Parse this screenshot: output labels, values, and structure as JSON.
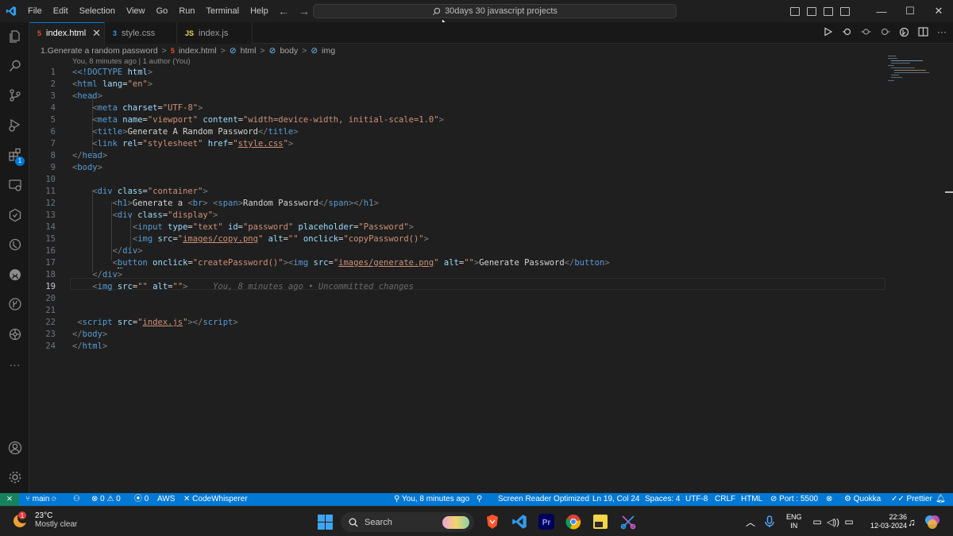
{
  "titlebar": {
    "menu": [
      "File",
      "Edit",
      "Selection",
      "View",
      "Go",
      "Run",
      "Terminal",
      "Help"
    ],
    "search": "30days 30 javascript projects",
    "window_controls": [
      "—",
      "☐",
      "✕"
    ]
  },
  "tabs": [
    {
      "icon_text": "5",
      "label": "index.html",
      "close": "✕"
    },
    {
      "icon_text": "3",
      "label": "style.css"
    },
    {
      "icon_text": "JS",
      "label": "index.js"
    }
  ],
  "activity_badge": "1",
  "breadcrumb": {
    "folder": "1.Generate a random password",
    "file": "index.html",
    "html": "html",
    "body": "body",
    "img": "img"
  },
  "blame_top": "You, 8 minutes ago | 1 author (You)",
  "editor": {
    "line_numbers": [
      "1",
      "2",
      "3",
      "4",
      "5",
      "6",
      "7",
      "8",
      "9",
      "10",
      "11",
      "12",
      "13",
      "14",
      "15",
      "16",
      "17",
      "18",
      "19",
      "20",
      "21",
      "22",
      "23",
      "24"
    ],
    "inline_blame": "You, 8 minutes ago • Uncommitted changes"
  },
  "code_tokens": {
    "doctype": "<!DOCTYPE",
    "html_kw": "html",
    "gt": ">",
    "lt": "<",
    "close_lt": "</",
    "tag_html": "html",
    "attr_lang": "lang",
    "eq": "=",
    "str_en": "\"en\"",
    "tag_head": "head",
    "tag_meta": "meta",
    "attr_charset": "charset",
    "str_utf8": "\"UTF-8\"",
    "attr_name": "name",
    "str_viewport": "\"viewport\"",
    "attr_content": "content",
    "str_content": "\"width=device-width, initial-scale=1.0\"",
    "tag_title": "title",
    "text_title": "Generate A Random Password",
    "tag_link": "link",
    "attr_rel": "rel",
    "str_stylesheet": "\"stylesheet\"",
    "attr_href": "href",
    "q": "\"",
    "str_style_css": "style.css",
    "tag_body": "body",
    "tag_div": "div",
    "attr_class": "class",
    "str_container": "\"container\"",
    "tag_h1": "h1",
    "text_generate_a": "Generate a ",
    "tag_br": "br",
    "tag_span": "span",
    "text_random_password": "Random Password",
    "str_display": "\"display\"",
    "tag_input": "input",
    "attr_type": "type",
    "str_text": "\"text\"",
    "attr_id": "id",
    "str_password": "\"password\"",
    "attr_placeholder": "placeholder",
    "str_Password": "\"Password\"",
    "tag_img": "img",
    "attr_src": "src",
    "str_copy": "images/copy.png",
    "attr_alt": "alt",
    "str_empty": "\"\"",
    "attr_onclick": "onclick",
    "str_copyPassword": "\"copyPassword()\"",
    "tag_button_b": "b",
    "tag_button_rest": "utton",
    "tag_button": "button",
    "str_createPassword": "\"createPassword()\"",
    "str_generate": "images/generate.png",
    "text_generate_password": "Generate Password",
    "tag_script": "script",
    "str_index_js": "index.js"
  },
  "statusbar": {
    "remote": "⨯",
    "branch": "main",
    "sync": "⟳",
    "errors": "⊗ 0 ⚠ 0",
    "ports": "0",
    "aws": "AWS",
    "codewhisperer": "CodeWhisperer",
    "blame": "You, 8 minutes ago",
    "screen_reader": "Screen Reader Optimized",
    "position": "Ln 19, Col 24",
    "spaces": "Spaces: 4",
    "encoding": "UTF-8",
    "eol": "CRLF",
    "language": "HTML",
    "port": "Port : 5500",
    "quokka": "Quokka",
    "prettier": "Prettier"
  },
  "taskbar": {
    "weather_badge": "1",
    "temp": "23°C",
    "condition": "Mostly clear",
    "search": "Search",
    "lang_top": "ENG",
    "lang_bottom": "IN",
    "time": "22:36",
    "date": "12-03-2024"
  },
  "colors": {
    "accent": "#0078d4",
    "tag": "#569cd6",
    "attribute": "#9cdcfe",
    "string": "#ce9178",
    "remote": "#16825d"
  }
}
